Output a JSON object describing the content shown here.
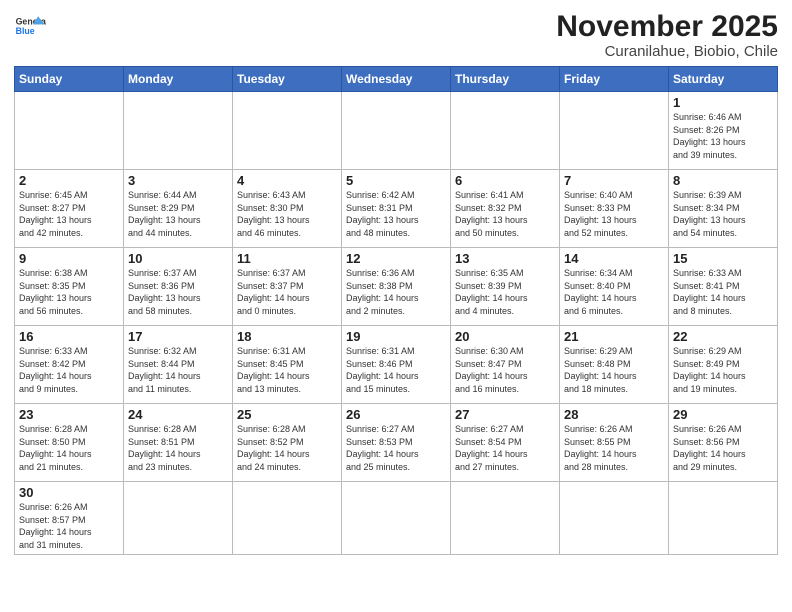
{
  "header": {
    "logo_general": "General",
    "logo_blue": "Blue",
    "month_year": "November 2025",
    "location": "Curanilahue, Biobio, Chile"
  },
  "weekdays": [
    "Sunday",
    "Monday",
    "Tuesday",
    "Wednesday",
    "Thursday",
    "Friday",
    "Saturday"
  ],
  "weeks": [
    [
      {
        "day": "",
        "info": ""
      },
      {
        "day": "",
        "info": ""
      },
      {
        "day": "",
        "info": ""
      },
      {
        "day": "",
        "info": ""
      },
      {
        "day": "",
        "info": ""
      },
      {
        "day": "",
        "info": ""
      },
      {
        "day": "1",
        "info": "Sunrise: 6:46 AM\nSunset: 8:26 PM\nDaylight: 13 hours\nand 39 minutes."
      }
    ],
    [
      {
        "day": "2",
        "info": "Sunrise: 6:45 AM\nSunset: 8:27 PM\nDaylight: 13 hours\nand 42 minutes."
      },
      {
        "day": "3",
        "info": "Sunrise: 6:44 AM\nSunset: 8:29 PM\nDaylight: 13 hours\nand 44 minutes."
      },
      {
        "day": "4",
        "info": "Sunrise: 6:43 AM\nSunset: 8:30 PM\nDaylight: 13 hours\nand 46 minutes."
      },
      {
        "day": "5",
        "info": "Sunrise: 6:42 AM\nSunset: 8:31 PM\nDaylight: 13 hours\nand 48 minutes."
      },
      {
        "day": "6",
        "info": "Sunrise: 6:41 AM\nSunset: 8:32 PM\nDaylight: 13 hours\nand 50 minutes."
      },
      {
        "day": "7",
        "info": "Sunrise: 6:40 AM\nSunset: 8:33 PM\nDaylight: 13 hours\nand 52 minutes."
      },
      {
        "day": "8",
        "info": "Sunrise: 6:39 AM\nSunset: 8:34 PM\nDaylight: 13 hours\nand 54 minutes."
      }
    ],
    [
      {
        "day": "9",
        "info": "Sunrise: 6:38 AM\nSunset: 8:35 PM\nDaylight: 13 hours\nand 56 minutes."
      },
      {
        "day": "10",
        "info": "Sunrise: 6:37 AM\nSunset: 8:36 PM\nDaylight: 13 hours\nand 58 minutes."
      },
      {
        "day": "11",
        "info": "Sunrise: 6:37 AM\nSunset: 8:37 PM\nDaylight: 14 hours\nand 0 minutes."
      },
      {
        "day": "12",
        "info": "Sunrise: 6:36 AM\nSunset: 8:38 PM\nDaylight: 14 hours\nand 2 minutes."
      },
      {
        "day": "13",
        "info": "Sunrise: 6:35 AM\nSunset: 8:39 PM\nDaylight: 14 hours\nand 4 minutes."
      },
      {
        "day": "14",
        "info": "Sunrise: 6:34 AM\nSunset: 8:40 PM\nDaylight: 14 hours\nand 6 minutes."
      },
      {
        "day": "15",
        "info": "Sunrise: 6:33 AM\nSunset: 8:41 PM\nDaylight: 14 hours\nand 8 minutes."
      }
    ],
    [
      {
        "day": "16",
        "info": "Sunrise: 6:33 AM\nSunset: 8:42 PM\nDaylight: 14 hours\nand 9 minutes."
      },
      {
        "day": "17",
        "info": "Sunrise: 6:32 AM\nSunset: 8:44 PM\nDaylight: 14 hours\nand 11 minutes."
      },
      {
        "day": "18",
        "info": "Sunrise: 6:31 AM\nSunset: 8:45 PM\nDaylight: 14 hours\nand 13 minutes."
      },
      {
        "day": "19",
        "info": "Sunrise: 6:31 AM\nSunset: 8:46 PM\nDaylight: 14 hours\nand 15 minutes."
      },
      {
        "day": "20",
        "info": "Sunrise: 6:30 AM\nSunset: 8:47 PM\nDaylight: 14 hours\nand 16 minutes."
      },
      {
        "day": "21",
        "info": "Sunrise: 6:29 AM\nSunset: 8:48 PM\nDaylight: 14 hours\nand 18 minutes."
      },
      {
        "day": "22",
        "info": "Sunrise: 6:29 AM\nSunset: 8:49 PM\nDaylight: 14 hours\nand 19 minutes."
      }
    ],
    [
      {
        "day": "23",
        "info": "Sunrise: 6:28 AM\nSunset: 8:50 PM\nDaylight: 14 hours\nand 21 minutes."
      },
      {
        "day": "24",
        "info": "Sunrise: 6:28 AM\nSunset: 8:51 PM\nDaylight: 14 hours\nand 23 minutes."
      },
      {
        "day": "25",
        "info": "Sunrise: 6:28 AM\nSunset: 8:52 PM\nDaylight: 14 hours\nand 24 minutes."
      },
      {
        "day": "26",
        "info": "Sunrise: 6:27 AM\nSunset: 8:53 PM\nDaylight: 14 hours\nand 25 minutes."
      },
      {
        "day": "27",
        "info": "Sunrise: 6:27 AM\nSunset: 8:54 PM\nDaylight: 14 hours\nand 27 minutes."
      },
      {
        "day": "28",
        "info": "Sunrise: 6:26 AM\nSunset: 8:55 PM\nDaylight: 14 hours\nand 28 minutes."
      },
      {
        "day": "29",
        "info": "Sunrise: 6:26 AM\nSunset: 8:56 PM\nDaylight: 14 hours\nand 29 minutes."
      }
    ],
    [
      {
        "day": "30",
        "info": "Sunrise: 6:26 AM\nSunset: 8:57 PM\nDaylight: 14 hours\nand 31 minutes."
      },
      {
        "day": "",
        "info": ""
      },
      {
        "day": "",
        "info": ""
      },
      {
        "day": "",
        "info": ""
      },
      {
        "day": "",
        "info": ""
      },
      {
        "day": "",
        "info": ""
      },
      {
        "day": "",
        "info": ""
      }
    ]
  ]
}
